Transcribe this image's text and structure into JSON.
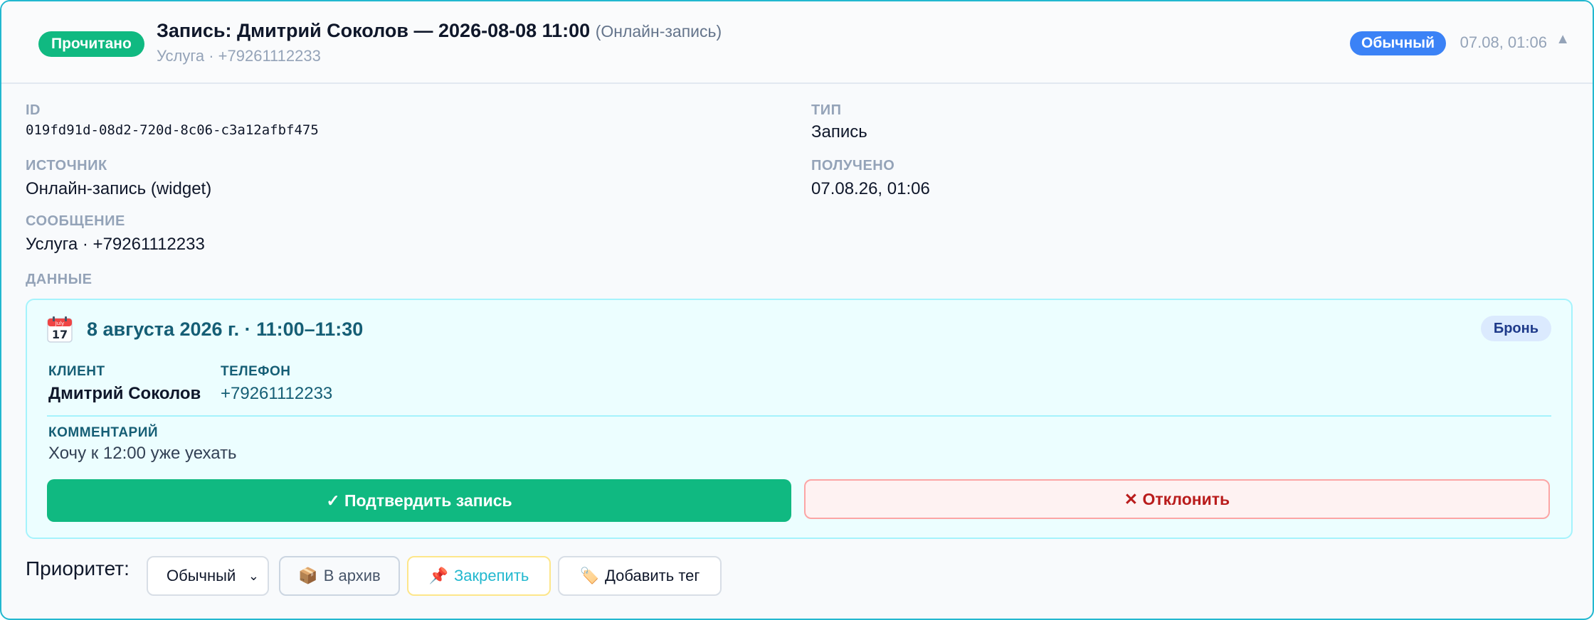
{
  "header": {
    "status_badge": "Прочитано",
    "title": "Запись: Дмитрий Соколов — 2026-08-08 11:00",
    "title_source": "(Онлайн-запись)",
    "subtitle": "Услуга · +79261112233",
    "priority_badge": "Обычный",
    "timestamp": "07.08, 01:06",
    "collapse_icon": "▲"
  },
  "fields": {
    "id_label": "ID",
    "id_value": "019fd91d-08d2-720d-8c06-c3a12afbf475",
    "type_label": "ТИП",
    "type_value": "Запись",
    "source_label": "ИСТОЧНИК",
    "source_value": "Онлайн-запись (widget)",
    "received_label": "ПОЛУЧЕНО",
    "received_value": "07.08.26, 01:06",
    "message_label": "СООБЩЕНИЕ",
    "message_value": "Услуга · +79261112233",
    "data_label": "ДАННЫЕ"
  },
  "booking": {
    "calendar_icon": "calendar-icon",
    "calendar_month": "July",
    "calendar_day": "17",
    "date_range": "8 августа 2026 г. · 11:00–11:30",
    "tag": "Бронь",
    "client_label": "КЛИЕНТ",
    "client_value": "Дмитрий Соколов",
    "phone_label": "ТЕЛЕФОН",
    "phone_value": "+79261112233",
    "comment_label": "КОММЕНТАРИЙ",
    "comment_value": "Хочу к 12:00 уже уехать",
    "confirm_label": "✓ Подтвердить запись",
    "reject_label": "✕ Отклонить"
  },
  "footer": {
    "priority_label": "Приоритет:",
    "priority_selected": "Обычный",
    "archive_icon": "📦",
    "archive_label": "В архив",
    "pin_icon": "📌",
    "pin_label": "Закрепить",
    "tag_icon": "🏷️",
    "tag_label": "Добавить тег"
  },
  "colors": {
    "accent": "#22b8cf",
    "success": "#10b981",
    "primary": "#3b82f6",
    "danger": "#b91c1c"
  }
}
